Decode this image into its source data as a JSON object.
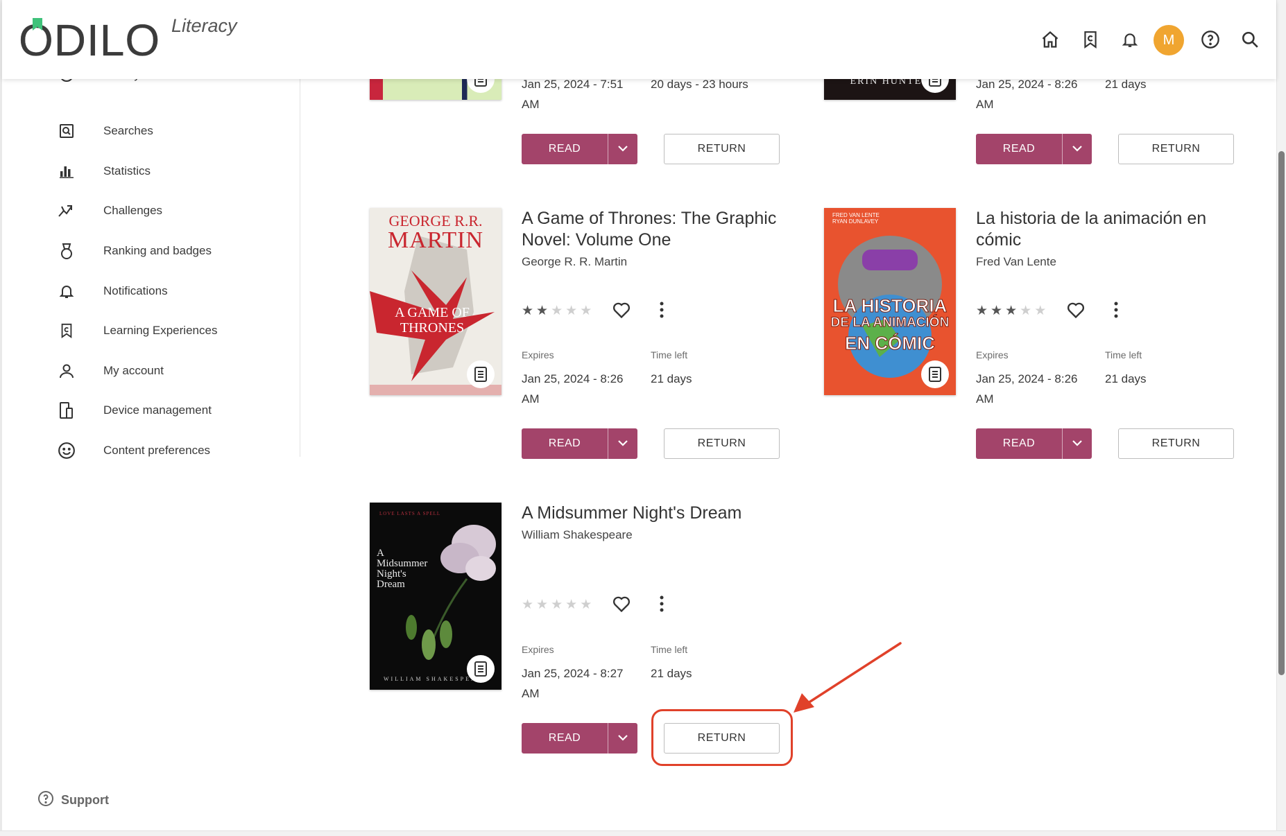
{
  "app": {
    "logo_text": "ODILO",
    "logo_subtitle": "Literacy",
    "avatar_initial": "M",
    "accent_color": "#a3446a",
    "highlight_color": "#e0412a"
  },
  "sidebar": {
    "items": [
      {
        "label": "History",
        "icon": "history-icon"
      },
      {
        "label": "Searches",
        "icon": "searches-icon"
      },
      {
        "label": "Statistics",
        "icon": "statistics-icon"
      },
      {
        "label": "Challenges",
        "icon": "challenges-icon"
      },
      {
        "label": "Ranking and badges",
        "icon": "badge-icon"
      },
      {
        "label": "Notifications",
        "icon": "bell-icon"
      },
      {
        "label": "Learning Experiences",
        "icon": "learning-icon"
      },
      {
        "label": "My account",
        "icon": "user-icon"
      },
      {
        "label": "Device management",
        "icon": "devices-icon"
      },
      {
        "label": "Content preferences",
        "icon": "smile-icon"
      }
    ],
    "support_label": "Support"
  },
  "labels": {
    "read": "READ",
    "return": "RETURN",
    "expires": "Expires",
    "time_left": "Time left"
  },
  "books": [
    {
      "id": "top-left",
      "expires_line1": "Jan 25, 2024 - 7:51",
      "expires_line2": "AM",
      "time_left": "20 days - 23 hours"
    },
    {
      "id": "top-right",
      "cover_text": "ERIN HUNTER",
      "expires_line1": "Jan 25, 2024 - 8:26",
      "expires_line2": "AM",
      "time_left": "21 days"
    },
    {
      "id": "got",
      "title_line1": "A Game of Thrones: The Graphic",
      "title_line2": "Novel: Volume One",
      "author": "George R. R. Martin",
      "rating": 2,
      "cover_top": "GEORGE R.R.",
      "cover_name": "MARTIN",
      "cover_title": "A GAME OF THRONES",
      "expires_line1": "Jan 25, 2024 - 8:26",
      "expires_line2": "AM",
      "time_left": "21 days"
    },
    {
      "id": "historia",
      "title_line1": "La historia de la animación en",
      "title_line2": "cómic",
      "author": "Fred Van Lente",
      "rating": 3,
      "cover_authors": "FRED VAN LENTE RYAN DUNLAVEY",
      "cover_title_1": "LA HISTORIA",
      "cover_title_2": "DE LA ANIMACIÓN",
      "cover_title_3": "EN CÓMIC",
      "expires_line1": "Jan 25, 2024 - 8:26",
      "expires_line2": "AM",
      "time_left": "21 days"
    },
    {
      "id": "midsummer",
      "title_line1": "A Midsummer Night's Dream",
      "author": "William Shakespeare",
      "rating": 0,
      "cover_tagline": "LOVE LASTS A SPELL",
      "cover_title": "A Midsummer Night's Dream",
      "cover_author": "WILLIAM SHAKESPEARE",
      "expires_line1": "Jan 25, 2024 - 8:27",
      "expires_line2": "AM",
      "time_left": "21 days"
    }
  ]
}
